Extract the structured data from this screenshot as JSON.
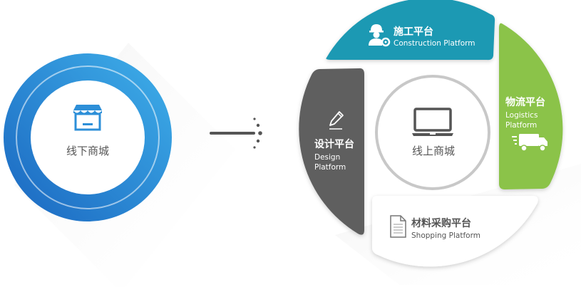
{
  "offline": {
    "title": "线下商城",
    "icon": "storefront-icon"
  },
  "arrow": {
    "icon": "arrow-right-icon"
  },
  "online": {
    "title": "线上商城",
    "icon": "laptop-icon",
    "platforms": {
      "construction": {
        "cn": "施工平台",
        "en": "Construction Platform",
        "icon": "worker-gear-icon",
        "color": "#1f99b3"
      },
      "logistics": {
        "cn": "物流平台",
        "en_line1": "Logistics",
        "en_line2": "Platform",
        "icon": "delivery-truck-icon",
        "color": "#8bc34a"
      },
      "shopping": {
        "cn": "材料采购平台",
        "en": "Shopping Platform",
        "icon": "document-icon",
        "color": "#ffffff"
      },
      "design": {
        "cn": "设计平台",
        "en_line1": "Design",
        "en_line2": "Platform",
        "icon": "pencil-icon",
        "color": "#5e5e5e"
      }
    }
  },
  "colors": {
    "blue_dark": "#1f78c8",
    "blue_light": "#3aa5e6",
    "gray_text": "#555555"
  }
}
